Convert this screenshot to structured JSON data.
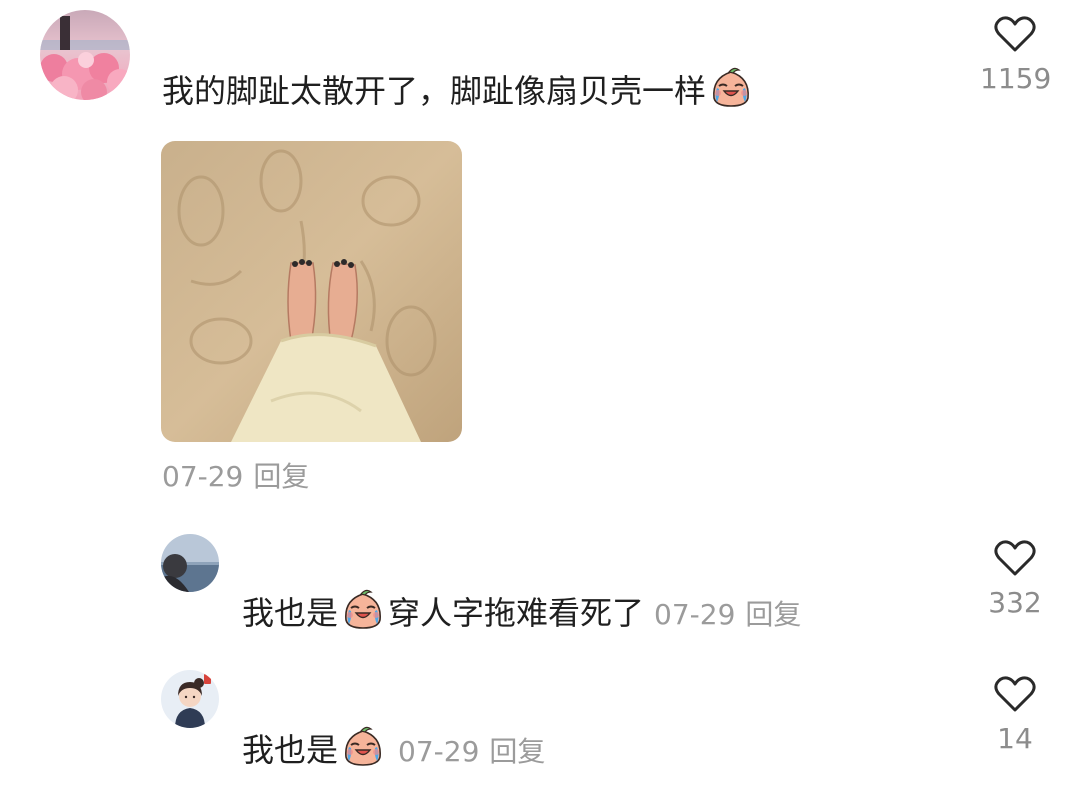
{
  "main_comment": {
    "avatar": "user-avatar-pink-flowers",
    "text_before_emoji": "我的脚趾太散开了，脚趾像扇贝壳一样",
    "emoji": "crying-face-emoji",
    "photo": "feet-on-sand-photo",
    "date": "07-29",
    "reply_label": "回复",
    "likes": "1159"
  },
  "replies": [
    {
      "avatar": "user-avatar-sea",
      "text_before_emoji": "我也是",
      "emoji": "crying-face-emoji",
      "text_after_emoji": "穿人字拖难看死了",
      "date": "07-29",
      "reply_label": "回复",
      "likes": "332"
    },
    {
      "avatar": "user-avatar-cartoon-girl",
      "text_before_emoji": "我也是",
      "emoji": "crying-face-emoji",
      "date": "07-29",
      "reply_label": "回复",
      "likes": "14"
    }
  ],
  "colors": {
    "text": "#1f1f1f",
    "meta": "#9b9b9b",
    "heart_outline": "#2a2a2a"
  }
}
